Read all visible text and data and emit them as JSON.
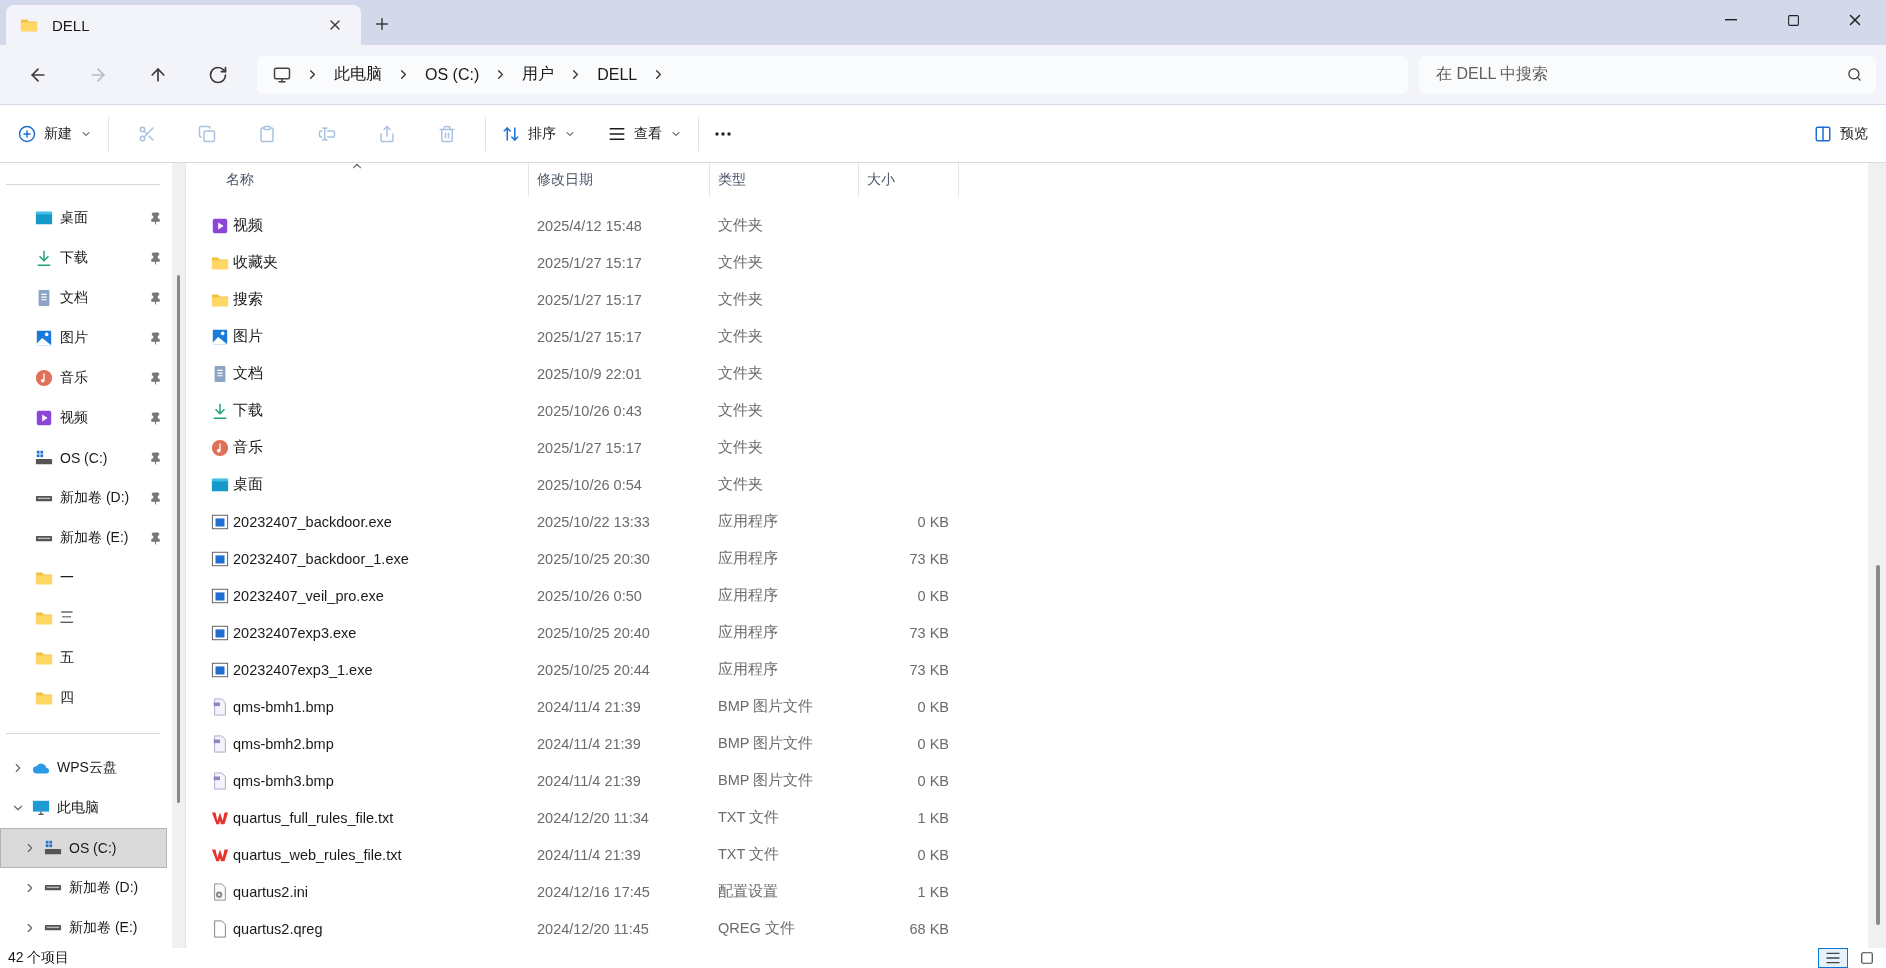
{
  "window": {
    "tab": {
      "title": "DELL",
      "kind": "folder"
    }
  },
  "nav": [
    {
      "kind": "back",
      "disabled": false
    },
    {
      "kind": "forward",
      "disabled": true
    },
    {
      "kind": "up",
      "disabled": false
    },
    {
      "kind": "refresh",
      "disabled": false
    }
  ],
  "address": {
    "crumbs": [
      "此电脑",
      "OS (C:)",
      "用户",
      "DELL"
    ]
  },
  "search": {
    "placeholder": "在 DELL 中搜索"
  },
  "toolbar": {
    "new": {
      "label": "新建"
    },
    "actions": [
      {
        "kind": "cut",
        "disabled": true
      },
      {
        "kind": "copy",
        "disabled": true
      },
      {
        "kind": "paste",
        "disabled": true
      },
      {
        "kind": "rename",
        "disabled": true
      },
      {
        "kind": "share",
        "disabled": true
      },
      {
        "kind": "delete",
        "disabled": true
      }
    ],
    "sort": {
      "label": "排序"
    },
    "view": {
      "label": "查看"
    },
    "preview": {
      "label": "预览"
    }
  },
  "sidebar": {
    "quick_access": [
      {
        "label": "桌面",
        "kind": "desktop",
        "pinned": true
      },
      {
        "label": "下载",
        "kind": "download",
        "pinned": true
      },
      {
        "label": "文档",
        "kind": "documents",
        "pinned": true
      },
      {
        "label": "图片",
        "kind": "pictures",
        "pinned": true
      },
      {
        "label": "音乐",
        "kind": "music",
        "pinned": true
      },
      {
        "label": "视频",
        "kind": "video",
        "pinned": true
      },
      {
        "label": "OS (C:)",
        "kind": "os-drive",
        "pinned": true
      },
      {
        "label": "新加卷 (D:)",
        "kind": "drive",
        "pinned": true
      },
      {
        "label": "新加卷 (E:)",
        "kind": "drive",
        "pinned": true
      },
      {
        "label": "一",
        "kind": "folder",
        "pinned": false
      },
      {
        "label": "三",
        "kind": "folder",
        "pinned": false
      },
      {
        "label": "五",
        "kind": "folder",
        "pinned": false
      },
      {
        "label": "四",
        "kind": "folder",
        "pinned": false
      }
    ],
    "tree": [
      {
        "label": "WPS云盘",
        "kind": "cloud",
        "expanded": false,
        "selected": false
      },
      {
        "label": "此电脑",
        "kind": "pc",
        "expanded": true,
        "selected": false,
        "children": [
          {
            "label": "OS (C:)",
            "kind": "os-drive",
            "expanded": false,
            "selected": true
          },
          {
            "label": "新加卷 (D:)",
            "kind": "drive",
            "expanded": false,
            "selected": false
          },
          {
            "label": "新加卷 (E:)",
            "kind": "drive",
            "expanded": false,
            "selected": false
          }
        ]
      }
    ]
  },
  "table": {
    "columns": [
      {
        "label": "名称",
        "sorted": true
      },
      {
        "label": "修改日期",
        "sorted": false
      },
      {
        "label": "类型",
        "sorted": false
      },
      {
        "label": "大小",
        "sorted": false
      }
    ],
    "rows": [
      {
        "name": "视频",
        "kind": "video",
        "date": "2025/4/12 15:48",
        "type": "文件夹"
      },
      {
        "name": "收藏夹",
        "kind": "folder",
        "date": "2025/1/27 15:17",
        "type": "文件夹"
      },
      {
        "name": "搜索",
        "kind": "folder",
        "date": "2025/1/27 15:17",
        "type": "文件夹"
      },
      {
        "name": "图片",
        "kind": "pictures",
        "date": "2025/1/27 15:17",
        "type": "文件夹"
      },
      {
        "name": "文档",
        "kind": "documents",
        "date": "2025/10/9 22:01",
        "type": "文件夹"
      },
      {
        "name": "下载",
        "kind": "download",
        "date": "2025/10/26 0:43",
        "type": "文件夹"
      },
      {
        "name": "音乐",
        "kind": "music",
        "date": "2025/1/27 15:17",
        "type": "文件夹"
      },
      {
        "name": "桌面",
        "kind": "desktop",
        "date": "2025/10/26 0:54",
        "type": "文件夹"
      },
      {
        "name": "20232407_backdoor.exe",
        "kind": "exe",
        "date": "2025/10/22 13:33",
        "type": "应用程序",
        "size": "0 KB"
      },
      {
        "name": "20232407_backdoor_1.exe",
        "kind": "exe",
        "date": "2025/10/25 20:30",
        "type": "应用程序",
        "size": "73 KB"
      },
      {
        "name": "20232407_veil_pro.exe",
        "kind": "exe",
        "date": "2025/10/26 0:50",
        "type": "应用程序",
        "size": "0 KB"
      },
      {
        "name": "20232407exp3.exe",
        "kind": "exe",
        "date": "2025/10/25 20:40",
        "type": "应用程序",
        "size": "73 KB"
      },
      {
        "name": "20232407exp3_1.exe",
        "kind": "exe",
        "date": "2025/10/25 20:44",
        "type": "应用程序",
        "size": "73 KB"
      },
      {
        "name": "qms-bmh1.bmp",
        "kind": "bmp",
        "date": "2024/11/4 21:39",
        "type": "BMP 图片文件",
        "size": "0 KB"
      },
      {
        "name": "qms-bmh2.bmp",
        "kind": "bmp",
        "date": "2024/11/4 21:39",
        "type": "BMP 图片文件",
        "size": "0 KB"
      },
      {
        "name": "qms-bmh3.bmp",
        "kind": "bmp",
        "date": "2024/11/4 21:39",
        "type": "BMP 图片文件",
        "size": "0 KB"
      },
      {
        "name": "quartus_full_rules_file.txt",
        "kind": "wps",
        "date": "2024/12/20 11:34",
        "type": "TXT 文件",
        "size": "1 KB"
      },
      {
        "name": "quartus_web_rules_file.txt",
        "kind": "wps",
        "date": "2024/11/4 21:39",
        "type": "TXT 文件",
        "size": "0 KB"
      },
      {
        "name": "quartus2.ini",
        "kind": "ini",
        "date": "2024/12/16 17:45",
        "type": "配置设置",
        "size": "1 KB"
      },
      {
        "name": "quartus2.qreg",
        "kind": "file",
        "date": "2024/12/20 11:45",
        "type": "QREG 文件",
        "size": "68 KB"
      }
    ]
  },
  "status_bar": {
    "count": "42 个项目",
    "views": [
      {
        "kind": "details",
        "selected": true
      },
      {
        "kind": "tiles",
        "selected": false
      }
    ]
  }
}
